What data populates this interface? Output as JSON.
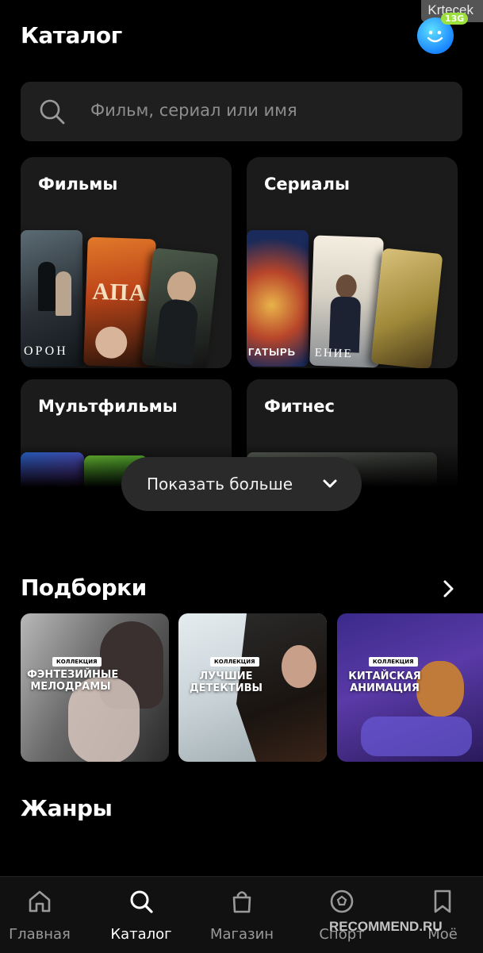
{
  "header": {
    "title": "Каталог",
    "avatar_badge": "13G"
  },
  "watermark": {
    "top": "Krtecek",
    "bottom": "RECOMMEND.RU"
  },
  "search": {
    "placeholder": "Фильм, сериал или имя",
    "icon": "search-icon"
  },
  "categories": [
    {
      "label": "Фильмы",
      "poster_texts": [
        "ОРОН",
        "АПА"
      ]
    },
    {
      "label": "Сериалы",
      "poster_texts": [
        "ГАТЫРЬ",
        "ЕНИЕ"
      ]
    },
    {
      "label": "Мультфильмы"
    },
    {
      "label": "Фитнес"
    }
  ],
  "show_more": {
    "label": "Показать больше",
    "icon": "chevron-down-icon"
  },
  "collections_section": {
    "title": "Подборки",
    "icon": "chevron-right-icon",
    "items": [
      {
        "badge": "КОЛЛЕКЦИЯ",
        "title": "ФЭНТЕЗИЙНЫЕ МЕЛОДРАМЫ",
        "color": "#8a8a8a"
      },
      {
        "badge": "КОЛЛЕКЦИЯ",
        "title": "ЛУЧШИЕ ДЕТЕКТИВЫ",
        "color": "#c9d3d8"
      },
      {
        "badge": "КОЛЛЕКЦИЯ",
        "title": "КИТАЙСКАЯ АНИМАЦИЯ",
        "color": "#4a3a9a"
      }
    ]
  },
  "genres_section": {
    "title": "Жанры"
  },
  "tabbar": {
    "items": [
      {
        "label": "Главная",
        "icon": "home-icon",
        "active": false
      },
      {
        "label": "Каталог",
        "icon": "search-icon",
        "active": true
      },
      {
        "label": "Магазин",
        "icon": "shopping-bag-icon",
        "active": false
      },
      {
        "label": "Спорт",
        "icon": "ball-icon",
        "active": false
      },
      {
        "label": "Моё",
        "icon": "bookmark-icon",
        "active": false
      }
    ]
  }
}
